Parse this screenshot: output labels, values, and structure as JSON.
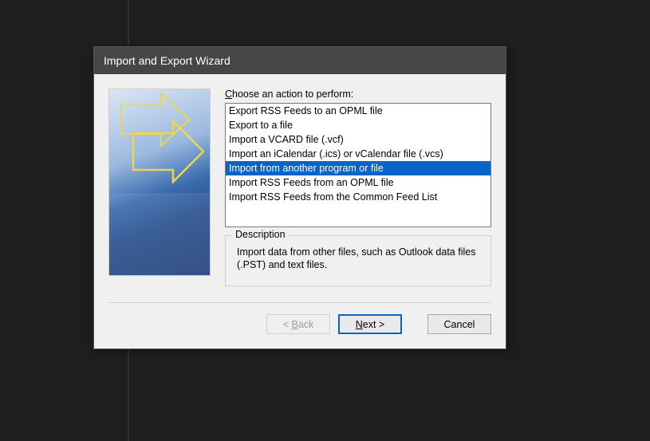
{
  "dialog": {
    "title": "Import and Export Wizard",
    "prompt_pre": "C",
    "prompt_post": "hoose an action to perform:",
    "actions": [
      {
        "label": "Export RSS Feeds to an OPML file",
        "selected": false
      },
      {
        "label": "Export to a file",
        "selected": false
      },
      {
        "label": "Import a VCARD file (.vcf)",
        "selected": false
      },
      {
        "label": "Import an iCalendar (.ics) or vCalendar file (.vcs)",
        "selected": false
      },
      {
        "label": "Import from another program or file",
        "selected": true
      },
      {
        "label": "Import RSS Feeds from an OPML file",
        "selected": false
      },
      {
        "label": "Import RSS Feeds from the Common Feed List",
        "selected": false
      }
    ],
    "description_legend": "Description",
    "description_text": "Import data from other files, such as Outlook data files (.PST) and text files.",
    "buttons": {
      "back_pre": "< ",
      "back_u": "B",
      "back_post": "ack",
      "next_u": "N",
      "next_post": "ext >",
      "cancel": "Cancel"
    }
  }
}
